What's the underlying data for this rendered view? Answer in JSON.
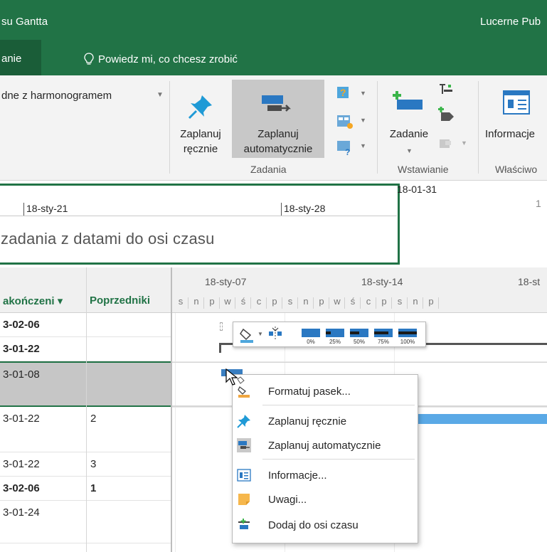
{
  "titlebar": {
    "title": "su Gantta",
    "user": "Lucerne Pub"
  },
  "tabs": {
    "active": "anie",
    "tell_me": "Powiedz mi, co chcesz zrobić"
  },
  "ribbon": {
    "combo_label": "dne z harmonogramem",
    "manual": {
      "line1": "Zaplanuj",
      "line2": "ręcznie"
    },
    "auto": {
      "line1": "Zaplanuj",
      "line2": "automatycznie"
    },
    "task": {
      "label": "Zadanie"
    },
    "info": {
      "label": "Informacje"
    },
    "groups": {
      "tasks": "Zadania",
      "insert": "Wstawianie",
      "properties": "Właściwo"
    }
  },
  "timeline": {
    "top_date": "18-01-31",
    "ticks": [
      "18-sty-21",
      "18-sty-28"
    ],
    "right_tick": "1",
    "placeholder": "zadania z datami do osi czasu"
  },
  "grid": {
    "col_end": "akończeni",
    "col_end_arrow": "▾",
    "col_pred": "Poprzedniki",
    "rows": [
      {
        "end": "3-02-06",
        "pred": "",
        "bold": true
      },
      {
        "end": "3-01-22",
        "pred": "",
        "bold": true
      },
      {
        "end": "3-01-08",
        "pred": "",
        "bold": false
      },
      {
        "end": "3-01-22",
        "pred": "2",
        "bold": false
      },
      {
        "end": "3-01-22",
        "pred": "3",
        "bold": false
      },
      {
        "end": "3-02-06",
        "pred": "1",
        "bold": true
      },
      {
        "end": "3-01-24",
        "pred": "",
        "bold": false
      }
    ]
  },
  "gantt": {
    "weeks": [
      "18-sty-07",
      "18-sty-14",
      "18-st"
    ],
    "days": [
      "s",
      "n",
      "p",
      "w",
      "ś",
      "c",
      "p",
      "s",
      "n",
      "p",
      "w",
      "ś",
      "c",
      "p",
      "s",
      "n",
      "p"
    ]
  },
  "minitoolbar": {
    "percents": [
      "0%",
      "25%",
      "50%",
      "75%",
      "100%"
    ]
  },
  "context_menu": {
    "items": [
      {
        "label": "Formatuj pasek...",
        "icon": "format-bar-icon"
      },
      {
        "label": "Zaplanuj ręcznie",
        "icon": "pushpin-icon"
      },
      {
        "label": "Zaplanuj automatycznie",
        "icon": "auto-schedule-icon"
      },
      {
        "label": "Informacje...",
        "icon": "information-icon"
      },
      {
        "label": "Uwagi...",
        "icon": "notes-icon"
      },
      {
        "label": "Dodaj do osi czasu",
        "icon": "add-to-timeline-icon"
      }
    ]
  },
  "colors": {
    "accent": "#217346",
    "bar": "#3a7fc2",
    "bar_light": "#5aa9e6"
  }
}
